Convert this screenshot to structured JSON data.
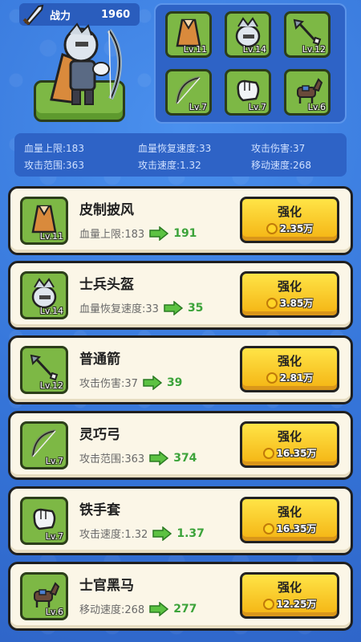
{
  "power": {
    "label": "战力",
    "value": "1960"
  },
  "slots": [
    {
      "name": "cloak",
      "lv": "Lv.11"
    },
    {
      "name": "helmet",
      "lv": "Lv.14"
    },
    {
      "name": "arrow",
      "lv": "Lv.12"
    },
    {
      "name": "bow",
      "lv": "Lv.7"
    },
    {
      "name": "gloves",
      "lv": "Lv.7"
    },
    {
      "name": "horse",
      "lv": "Lv.6"
    }
  ],
  "stats": [
    "血量上限:183",
    "血量恢复速度:33",
    "攻击伤害:37",
    "攻击范围:363",
    "攻击速度:1.32",
    "移动速度:268"
  ],
  "items": [
    {
      "name": "皮制披风",
      "stat": "血量上限:183",
      "next": "191",
      "lv": "Lv.11",
      "button": "强化",
      "cost": "2.35万"
    },
    {
      "name": "士兵头盔",
      "stat": "血量恢复速度:33",
      "next": "35",
      "lv": "Lv.14",
      "button": "强化",
      "cost": "3.85万"
    },
    {
      "name": "普通箭",
      "stat": "攻击伤害:37",
      "next": "39",
      "lv": "Lv.12",
      "button": "强化",
      "cost": "2.81万"
    },
    {
      "name": "灵巧弓",
      "stat": "攻击范围:363",
      "next": "374",
      "lv": "Lv.7",
      "button": "强化",
      "cost": "16.35万"
    },
    {
      "name": "铁手套",
      "stat": "攻击速度:1.32",
      "next": "1.37",
      "lv": "Lv.7",
      "button": "强化",
      "cost": "16.35万"
    },
    {
      "name": "士官黑马",
      "stat": "移动速度:268",
      "next": "277",
      "lv": "Lv.6",
      "button": "强化",
      "cost": "12.25万"
    }
  ]
}
